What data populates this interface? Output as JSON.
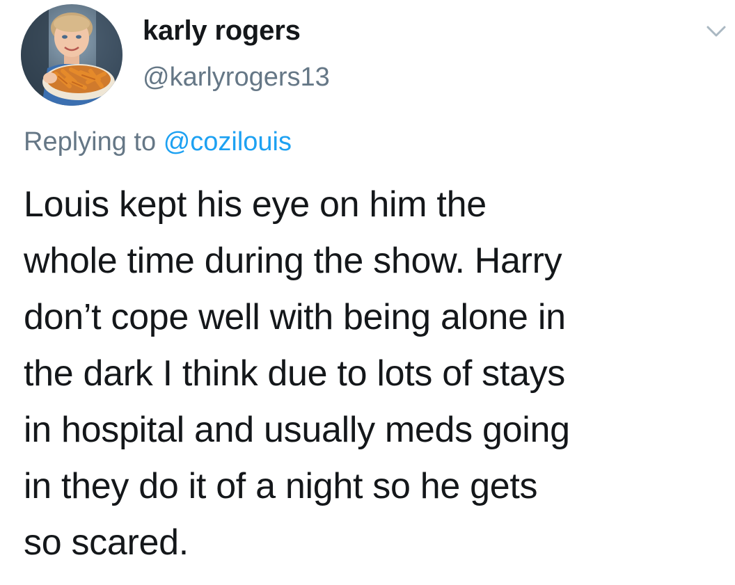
{
  "tweet": {
    "author": {
      "display_name": "karly rogers",
      "handle": "@karlyrogers13",
      "avatar": "profile-photo-child-with-food-bowl"
    },
    "reply": {
      "prefix": "Replying to",
      "mention": "@cozilouis"
    },
    "text_lines": [
      "Louis kept his eye on him the",
      "whole time during the show. Harry",
      "don’t cope well with being alone in",
      "the dark I think due to lots of stays",
      "in hospital and usually meds going",
      "in they do it of a night so he gets",
      "so scared."
    ],
    "menu_icon": "chevron-down-icon"
  },
  "colors": {
    "text_primary": "#14171a",
    "text_secondary": "#657786",
    "link": "#1da1f2",
    "background": "#ffffff",
    "chevron": "#aab8c2"
  }
}
